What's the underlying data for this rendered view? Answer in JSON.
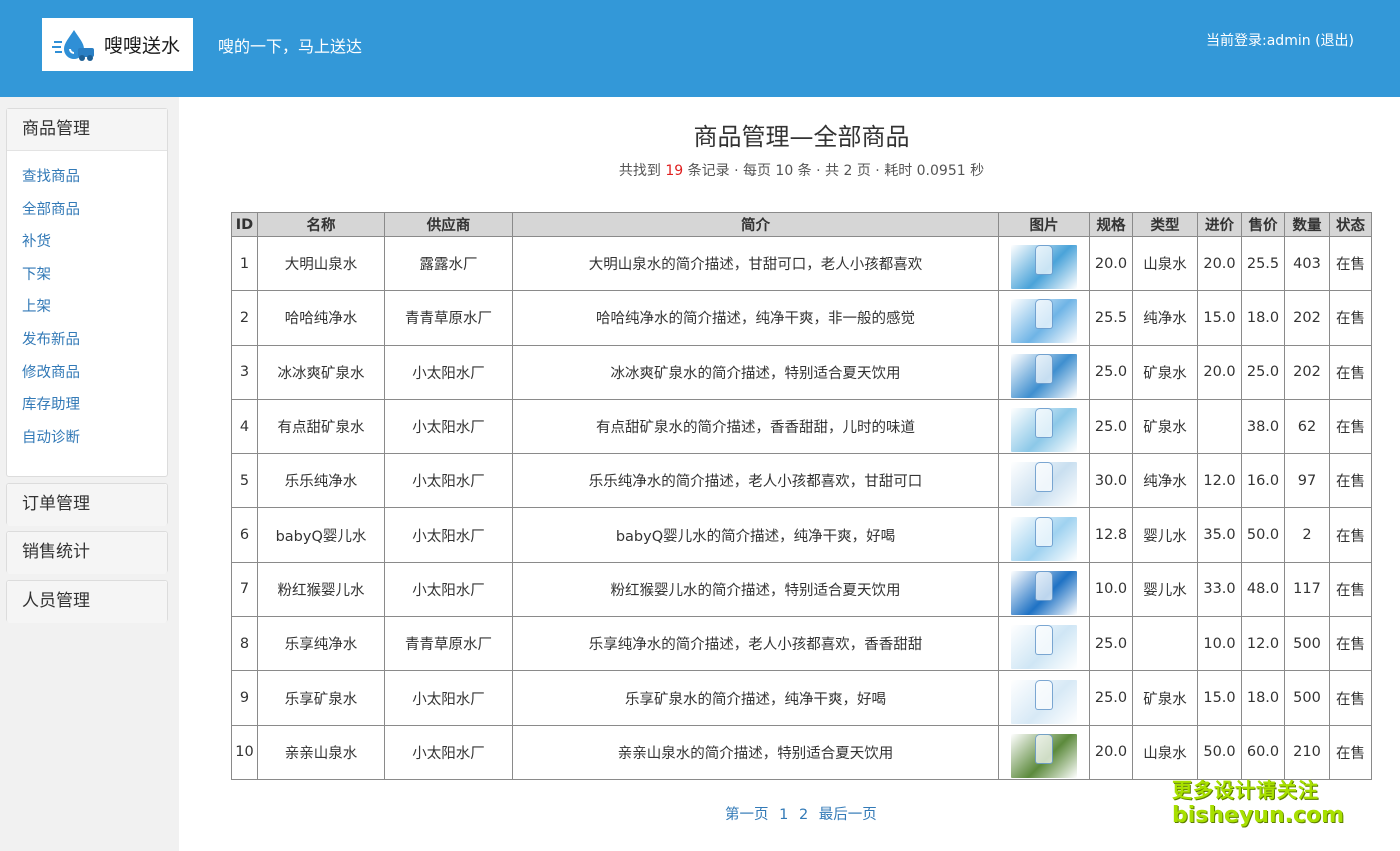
{
  "header": {
    "brand": "嗖嗖送水",
    "slogan": "嗖的一下，马上送达",
    "login_prefix": "当前登录:admin",
    "logout_label": "(退出)",
    "bg_color": "#3398d8"
  },
  "sidebar": {
    "goods_panel": {
      "title": "商品管理",
      "items": [
        {
          "label": "查找商品"
        },
        {
          "label": "全部商品"
        },
        {
          "label": "补货"
        },
        {
          "label": "下架"
        },
        {
          "label": "上架"
        },
        {
          "label": "发布新品"
        },
        {
          "label": "修改商品"
        },
        {
          "label": "库存助理"
        },
        {
          "label": "自动诊断"
        }
      ]
    },
    "order_panel": {
      "title": "订单管理"
    },
    "sales_panel": {
      "title": "销售统计"
    },
    "staff_panel": {
      "title": "人员管理"
    }
  },
  "main": {
    "title": "商品管理—全部商品",
    "summary_prefix": "共找到 ",
    "summary_count": "19",
    "summary_suffix": " 条记录 · 每页 10 条 · 共 2 页 · 耗时 0.0951 秒",
    "table": {
      "headers": [
        "ID",
        "名称",
        "供应商",
        "简介",
        "图片",
        "规格",
        "类型",
        "进价",
        "售价",
        "数量",
        "状态"
      ],
      "rows": [
        {
          "id": "1",
          "name": "大明山泉水",
          "supplier": "露露水厂",
          "desc": "大明山泉水的简介描述，甘甜可口，老人小孩都喜欢",
          "spec": "20.0",
          "type": "山泉水",
          "cost": "20.0",
          "price": "25.5",
          "qty": "403",
          "status": "在售",
          "img_color": "#4aa3d9"
        },
        {
          "id": "2",
          "name": "哈哈纯净水",
          "supplier": "青青草原水厂",
          "desc": "哈哈纯净水的简介描述，纯净干爽，非一般的感觉",
          "spec": "25.5",
          "type": "纯净水",
          "cost": "15.0",
          "price": "18.0",
          "qty": "202",
          "status": "在售",
          "img_color": "#6fb4e6"
        },
        {
          "id": "3",
          "name": "冰冰爽矿泉水",
          "supplier": "小太阳水厂",
          "desc": "冰冰爽矿泉水的简介描述，特别适合夏天饮用",
          "spec": "25.0",
          "type": "矿泉水",
          "cost": "20.0",
          "price": "25.0",
          "qty": "202",
          "status": "在售",
          "img_color": "#3f8fcf"
        },
        {
          "id": "4",
          "name": "有点甜矿泉水",
          "supplier": "小太阳水厂",
          "desc": "有点甜矿泉水的简介描述，香香甜甜，儿时的味道",
          "spec": "25.0",
          "type": "矿泉水",
          "cost": "",
          "price": "38.0",
          "qty": "62",
          "status": "在售",
          "img_color": "#8cc8e8"
        },
        {
          "id": "5",
          "name": "乐乐纯净水",
          "supplier": "小太阳水厂",
          "desc": "乐乐纯净水的简介描述，老人小孩都喜欢，甘甜可口",
          "spec": "30.0",
          "type": "纯净水",
          "cost": "12.0",
          "price": "16.0",
          "qty": "97",
          "status": "在售",
          "img_color": "#c9dff0"
        },
        {
          "id": "6",
          "name": "babyQ婴儿水",
          "supplier": "小太阳水厂",
          "desc": "babyQ婴儿水的简介描述，纯净干爽，好喝",
          "spec": "12.8",
          "type": "婴儿水",
          "cost": "35.0",
          "price": "50.0",
          "qty": "2",
          "status": "在售",
          "img_color": "#9fd2f0"
        },
        {
          "id": "7",
          "name": "粉红猴婴儿水",
          "supplier": "小太阳水厂",
          "desc": "粉红猴婴儿水的简介描述，特别适合夏天饮用",
          "spec": "10.0",
          "type": "婴儿水",
          "cost": "33.0",
          "price": "48.0",
          "qty": "117",
          "status": "在售",
          "img_color": "#1f72c4"
        },
        {
          "id": "8",
          "name": "乐享纯净水",
          "supplier": "青青草原水厂",
          "desc": "乐享纯净水的简介描述，老人小孩都喜欢，香香甜甜",
          "spec": "25.0",
          "type": "",
          "cost": "10.0",
          "price": "12.0",
          "qty": "500",
          "status": "在售",
          "img_color": "#cfe6f5"
        },
        {
          "id": "9",
          "name": "乐享矿泉水",
          "supplier": "小太阳水厂",
          "desc": "乐享矿泉水的简介描述，纯净干爽，好喝",
          "spec": "25.0",
          "type": "矿泉水",
          "cost": "15.0",
          "price": "18.0",
          "qty": "500",
          "status": "在售",
          "img_color": "#d7e9f6"
        },
        {
          "id": "10",
          "name": "亲亲山泉水",
          "supplier": "小太阳水厂",
          "desc": "亲亲山泉水的简介描述，特别适合夏天饮用",
          "spec": "20.0",
          "type": "山泉水",
          "cost": "50.0",
          "price": "60.0",
          "qty": "210",
          "status": "在售",
          "img_color": "#5c8a3c"
        }
      ]
    },
    "pager": {
      "first": "第一页",
      "p1": "1",
      "p2": "2",
      "last": "最后一页"
    }
  },
  "watermark": {
    "line1": "更多设计请关注",
    "line2": "bisheyun.com"
  }
}
